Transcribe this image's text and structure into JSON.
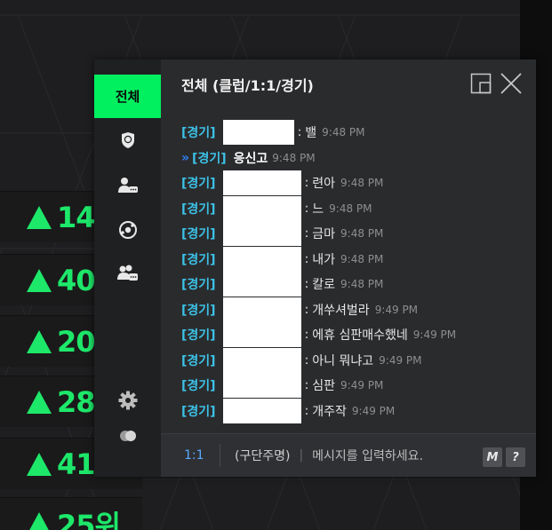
{
  "background": {
    "rank_rows": [
      {
        "text": "14"
      },
      {
        "text": "40"
      },
      {
        "text": "20"
      },
      {
        "text": "28"
      },
      {
        "text": "41"
      },
      {
        "text": "25위"
      }
    ]
  },
  "chat": {
    "title": "전체 (클럽/1:1/경기)",
    "sidebar": {
      "active_tab": "전체",
      "icons": [
        "club-shield-icon",
        "friend-chat-icon",
        "match-ball-icon",
        "group-chat-icon",
        "settings-gear-icon",
        "toggle-icon"
      ]
    },
    "messages": [
      {
        "tag": "[경기]",
        "text": "밸",
        "time": "9:48 PM"
      },
      {
        "arrow": "»",
        "tag": "[경기]",
        "name": "응신고",
        "time": "9:48 PM"
      },
      {
        "tag": "[경기]",
        "text": "련아",
        "time": "9:48 PM"
      },
      {
        "tag": "[경기]",
        "text": "느",
        "time": "9:48 PM"
      },
      {
        "tag": "[경기]",
        "text": "금마",
        "time": "9:48 PM"
      },
      {
        "tag": "[경기]",
        "text": "내가",
        "time": "9:48 PM"
      },
      {
        "tag": "[경기]",
        "text": "칼로",
        "time": "9:48 PM"
      },
      {
        "tag": "[경기]",
        "text": "개쑤셔벌라",
        "time": "9:49 PM"
      },
      {
        "tag": "[경기]",
        "text": "에휴 심판매수했네",
        "time": "9:49 PM"
      },
      {
        "tag": "[경기]",
        "text": "아니 뭐냐고",
        "time": "9:49 PM"
      },
      {
        "tag": "[경기]",
        "text": "심판",
        "time": "9:49 PM"
      },
      {
        "tag": "[경기]",
        "text": "개주작",
        "time": "9:49 PM"
      }
    ],
    "input": {
      "mode": "1:1",
      "target": "(구단주명)",
      "separator": "|",
      "placeholder": "메시지를 입력하세요.",
      "macro_label": "M",
      "help_label": "?"
    },
    "colors": {
      "accent_green": "#00f060",
      "tag_cyan": "#3cc1e6",
      "mode_blue": "#58a9ff"
    }
  }
}
